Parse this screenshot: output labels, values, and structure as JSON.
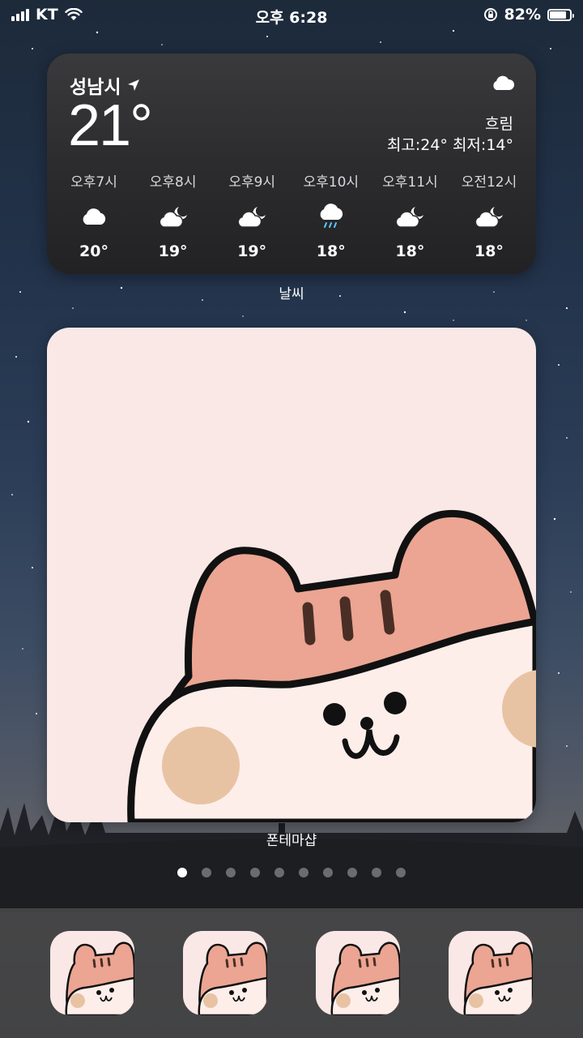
{
  "status_bar": {
    "carrier": "KT",
    "time": "오후 6:28",
    "battery_percent": "82%",
    "battery_level": 0.82,
    "icons": [
      "signal-icon",
      "wifi-icon",
      "orientation-lock-icon",
      "battery-icon"
    ]
  },
  "weather_widget": {
    "city": "성남시",
    "temperature": "21°",
    "condition": "흐림",
    "high_low": "최고:24° 최저:14°",
    "condition_icon": "cloud-icon",
    "hourly": [
      {
        "time": "오후7시",
        "icon": "cloud-icon",
        "temp": "20°"
      },
      {
        "time": "오후8시",
        "icon": "cloud-moon-icon",
        "temp": "19°"
      },
      {
        "time": "오후9시",
        "icon": "cloud-moon-icon",
        "temp": "19°"
      },
      {
        "time": "오후10시",
        "icon": "cloud-rain-icon",
        "temp": "18°"
      },
      {
        "time": "오후11시",
        "icon": "cloud-moon-icon",
        "temp": "18°"
      },
      {
        "time": "오전12시",
        "icon": "cloud-moon-icon",
        "temp": "18°"
      }
    ],
    "label": "날씨"
  },
  "photo_widget": {
    "label": "폰테마샵"
  },
  "page_dots": {
    "count": 10,
    "active_index": 0
  },
  "dock": {
    "apps": [
      {
        "name": "hamster-app-icon"
      },
      {
        "name": "hamster-app-icon"
      },
      {
        "name": "hamster-app-icon"
      },
      {
        "name": "hamster-app-icon"
      }
    ]
  },
  "colors": {
    "hamster_pink": "#eba592",
    "hamster_cream": "#fdeeea",
    "cheek": "#e8c3a3",
    "widget_bg": "#f9e8e6"
  }
}
